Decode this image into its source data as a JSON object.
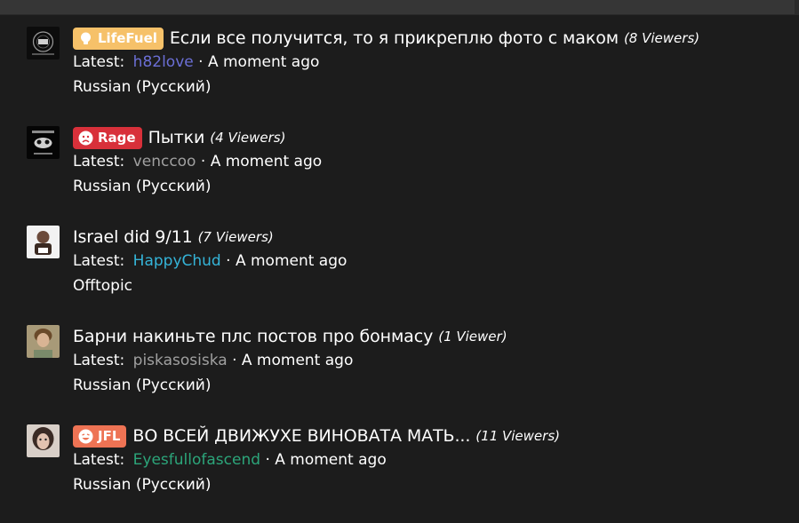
{
  "threads": [
    {
      "prefix": "LifeFuel",
      "prefix_icon": "lightbulb-icon",
      "title": "Если все получится, то я прикреплю фото с маком",
      "viewers": "(8 Viewers)",
      "latest_label": "Latest:",
      "latest_user": "h82love",
      "latest_user_color": "#6b6fd6",
      "separator": "·",
      "time": "A moment ago",
      "forum": "Russian (Русский)"
    },
    {
      "prefix": "Rage",
      "prefix_icon": "angry-face-icon",
      "title": "Пытки",
      "viewers": "(4 Viewers)",
      "latest_label": "Latest:",
      "latest_user": "venccoo",
      "latest_user_color": "#a0a0a0",
      "separator": "·",
      "time": "A moment ago",
      "forum": "Russian (Русский)"
    },
    {
      "prefix": "",
      "title": "Israel did 9/11",
      "viewers": "(7 Viewers)",
      "latest_label": "Latest:",
      "latest_user": "HappyChud",
      "latest_user_color": "#35b4d8",
      "separator": "·",
      "time": "A moment ago",
      "forum": "Offtopic"
    },
    {
      "prefix": "",
      "title": "Барни накиньте плс постов про бонмасу",
      "viewers": "(1 Viewer)",
      "latest_label": "Latest:",
      "latest_user": "piskasosiska",
      "latest_user_color": "#a0a0a0",
      "separator": "·",
      "time": "A moment ago",
      "forum": "Russian (Русский)"
    },
    {
      "prefix": "JFL",
      "prefix_icon": "laughing-face-icon",
      "title": "ВО ВСЕЙ ДВИЖУХЕ ВИНОВАТА МАТЬ...",
      "viewers": "(11 Viewers)",
      "latest_label": "Latest:",
      "latest_user": "Eyesfullofascend",
      "latest_user_color": "#2ca57a",
      "separator": "·",
      "time": "A moment ago",
      "forum": "Russian (Русский)"
    }
  ]
}
